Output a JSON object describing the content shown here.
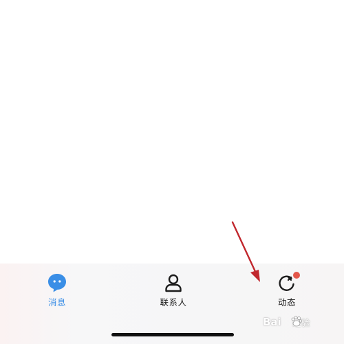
{
  "tab_bar": {
    "tabs": [
      {
        "label": "消息",
        "icon": "chat-bubble-icon",
        "active": true
      },
      {
        "label": "联系人",
        "icon": "contact-person-icon",
        "active": false
      },
      {
        "label": "动态",
        "icon": "moments-refresh-icon",
        "active": false,
        "badge": "red-dot"
      }
    ]
  },
  "colors": {
    "accent": "#3a8ee6",
    "annotation_arrow": "#c1272d",
    "badge": "#e4574a"
  },
  "watermark": {
    "brand": "Bai",
    "brand_suffix": "经验"
  }
}
